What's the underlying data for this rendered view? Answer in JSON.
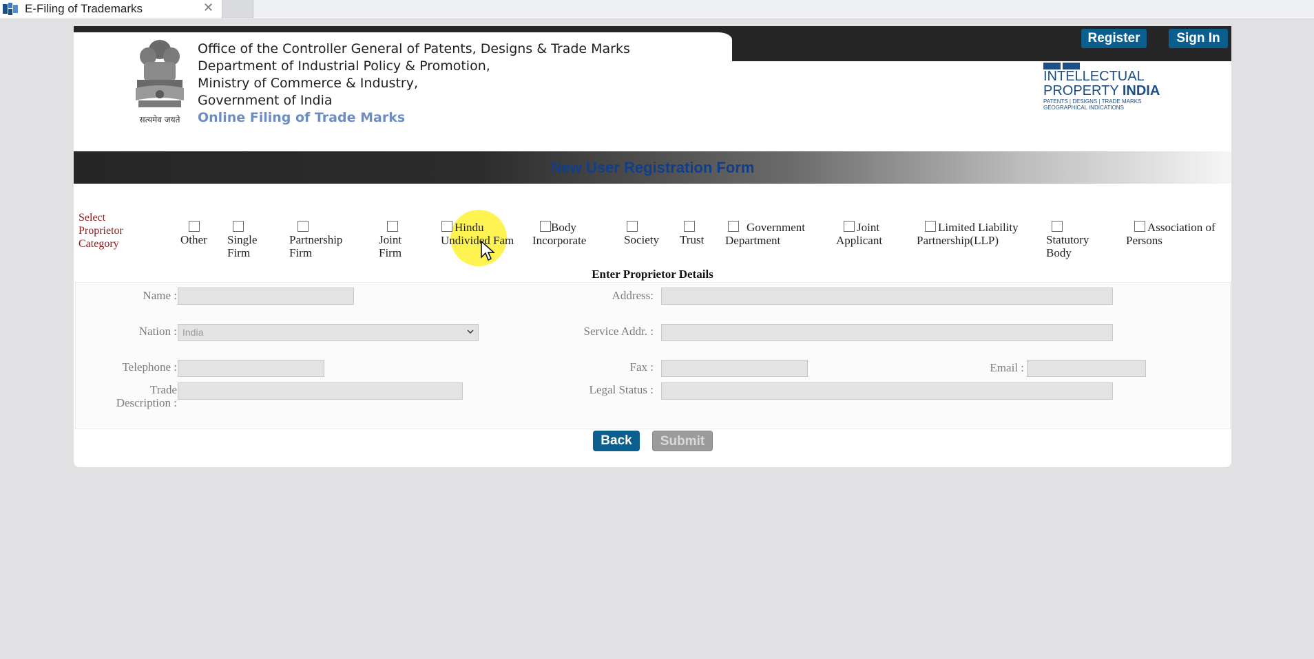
{
  "browser": {
    "tab_title": "E-Filing of Trademarks",
    "tab_close": "✕"
  },
  "header": {
    "lines": [
      "Office of the Controller General of Patents, Designs & Trade Marks",
      "Department of Industrial Policy & Promotion,",
      "Ministry of Commerce & Industry,",
      "Government of India"
    ],
    "subtitle": "Online Filing of Trade Marks",
    "emblem_caption": "सत्यमेव जयते",
    "register_label": "Register",
    "signin_label": "Sign In",
    "logo": {
      "line1": "INTELLECTUAL",
      "line2a": "PROPERTY",
      "line2b": "INDIA",
      "line3": "PATENTS | DESIGNS | TRADE MARKS",
      "line4": "GEOGRAPHICAL INDICATIONS"
    }
  },
  "form": {
    "title": "New User Registration Form",
    "category_label": "Select Proprietor Category",
    "categories": [
      {
        "label": "Other",
        "checked": false
      },
      {
        "label": "Single Firm",
        "checked": false
      },
      {
        "label": "Partnership Firm",
        "checked": false
      },
      {
        "label": "Joint Firm",
        "checked": false
      },
      {
        "label": "Hindu Undivided Fam",
        "checked": false
      },
      {
        "label": "Body Incorporate",
        "checked": false
      },
      {
        "label": "Society",
        "checked": false
      },
      {
        "label": "Trust",
        "checked": false
      },
      {
        "label": "Government Department",
        "checked": false
      },
      {
        "label": "Joint Applicant",
        "checked": false
      },
      {
        "label": "Limited Liability Partnership(LLP)",
        "checked": false
      },
      {
        "label": "Statutory Body",
        "checked": false
      },
      {
        "label": "Association of Persons",
        "checked": false
      }
    ],
    "details_title": "Enter Proprietor Details",
    "fields": {
      "name_label": "Name :",
      "address_label": "Address:",
      "nation_label": "Nation :",
      "nation_value": "India",
      "service_addr_label": "Service Addr. :",
      "telephone_label": "Telephone :",
      "fax_label": "Fax :",
      "email_label": "Email :",
      "trade_desc_label_1": "Trade",
      "trade_desc_label_2": "Description :",
      "legal_status_label": "Legal Status :"
    },
    "back_label": "Back",
    "submit_label": "Submit"
  },
  "colors": {
    "accent": "#0b5f8f",
    "band_dark": "#262626",
    "title_blue": "#0f3f8c",
    "category_label": "#8b1a1a",
    "cursor_highlight": "#fff23f"
  }
}
